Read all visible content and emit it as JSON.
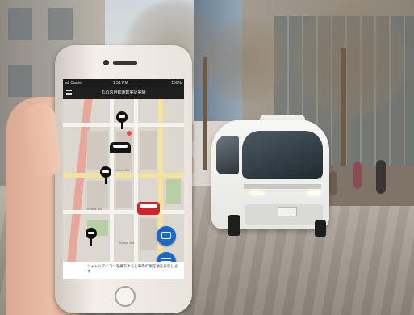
{
  "phone": {
    "status_bar": {
      "carrier": "all Carrier",
      "time": "1:51 PM",
      "battery": "100%"
    },
    "app_title": "丸の内自動運転実証実験",
    "map": {
      "street_labels": [
        "Kenzo-3rd",
        "Kunita 3rd",
        "Kuzza 3rd"
      ]
    },
    "footer_text": "シャトルアイコンを押下すると車両の現在地を表示します"
  },
  "icons": {
    "menu": "hamburger-menu-icon",
    "stop_pins": [
      "bus-stop-pin-icon",
      "bus-stop-pin-icon",
      "bus-stop-pin-icon"
    ],
    "vehicle": "shuttle-vehicle-icon",
    "bus": "red-bus-icon",
    "fab_top": "vehicle-list-icon",
    "fab_bottom": "timetable-icon"
  },
  "colors": {
    "fab_blue": "#1a66c9",
    "bus_red": "#d2232a",
    "shuttle_white": "#f4f4f2"
  }
}
